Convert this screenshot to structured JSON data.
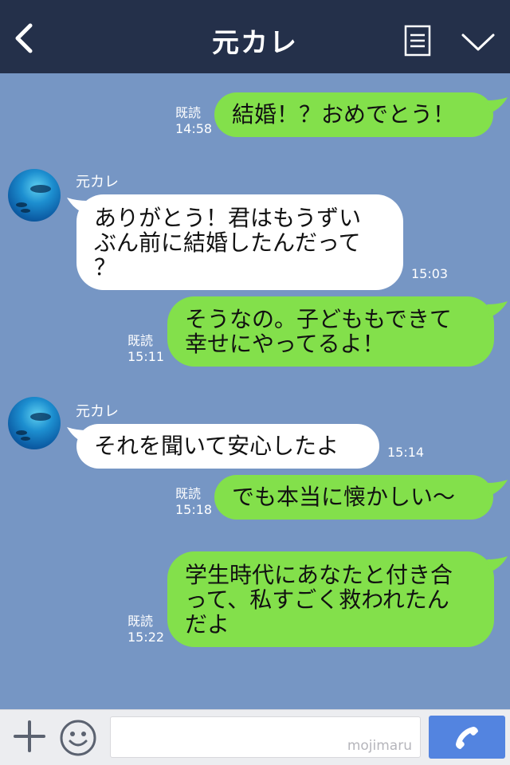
{
  "header": {
    "title": "元カレ",
    "back_icon": "chevron-left-icon",
    "notes_icon": "notes-icon",
    "menu_icon": "chevron-down-icon"
  },
  "contact": {
    "name": "元カレ"
  },
  "messages": [
    {
      "from": "me",
      "text": "結婚！？おめでとう！",
      "read": "既読",
      "time": "14:58"
    },
    {
      "from": "you",
      "sender": "元カレ",
      "text": "ありがとう！君はもうずい\nぶん前に結婚したんだって\n？",
      "time": "15:03"
    },
    {
      "from": "me",
      "text": "そうなの。子どももできて\n幸せにやってるよ！",
      "read": "既読",
      "time": "15:11"
    },
    {
      "from": "you",
      "sender": "元カレ",
      "text": "それを聞いて安心したよ",
      "time": "15:14"
    },
    {
      "from": "me",
      "text": "でも本当に懐かしい〜",
      "read": "既読",
      "time": "15:18"
    },
    {
      "from": "me",
      "text": "学生時代にあなたと付き合\nって、私すごく救われたん\nだよ",
      "read": "既読",
      "time": "15:22"
    }
  ],
  "footer": {
    "plus_icon": "plus-icon",
    "emoji_icon": "smile-icon",
    "input_value": "",
    "watermark": "mojimaru",
    "call_icon": "phone-icon"
  },
  "colors": {
    "header_bg": "#24304a",
    "chat_bg": "#7696c4",
    "my_bubble": "#83e04b",
    "their_bubble": "#ffffff",
    "call_button": "#5384e0"
  }
}
